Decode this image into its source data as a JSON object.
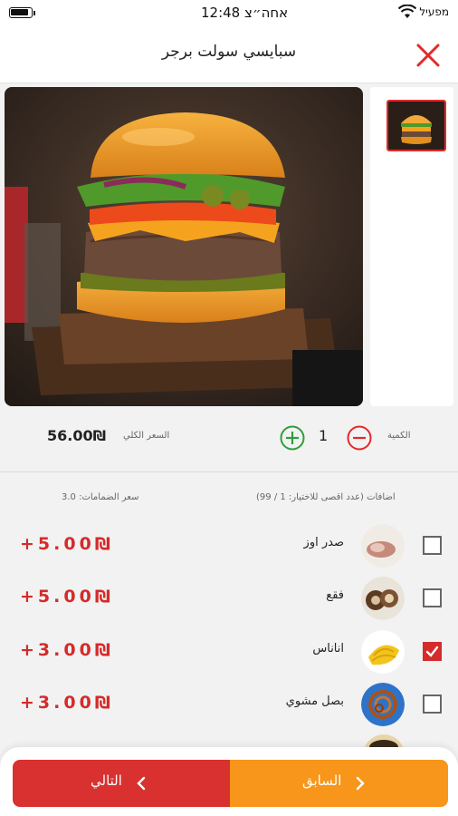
{
  "status_bar": {
    "time": "12:48 אחה״צ",
    "carrier": "מפעיל"
  },
  "header": {
    "title": "سبايسي سولت برجر"
  },
  "product": {
    "price_label": "السعر الكلي",
    "price_value": "56.00₪",
    "quantity_label": "الكمية",
    "quantity_value": "1"
  },
  "addons": {
    "title": "اضافات (عدد اقصى للاختيار: 1 / 99)",
    "price_label": "سعر الضمامات: 3.0",
    "items": [
      {
        "name": "صدر اوز",
        "price": "+5.00₪",
        "checked": false
      },
      {
        "name": "فقع",
        "price": "+5.00₪",
        "checked": false
      },
      {
        "name": "اناناس",
        "price": "+3.00₪",
        "checked": true
      },
      {
        "name": "بصل مشوي",
        "price": "+3.00₪",
        "checked": false
      }
    ]
  },
  "footer": {
    "next_label": "التالي",
    "prev_label": "السابق"
  },
  "colors": {
    "accent_red": "#d93030",
    "accent_orange": "#f7961a",
    "price_red": "#d42b2b"
  }
}
